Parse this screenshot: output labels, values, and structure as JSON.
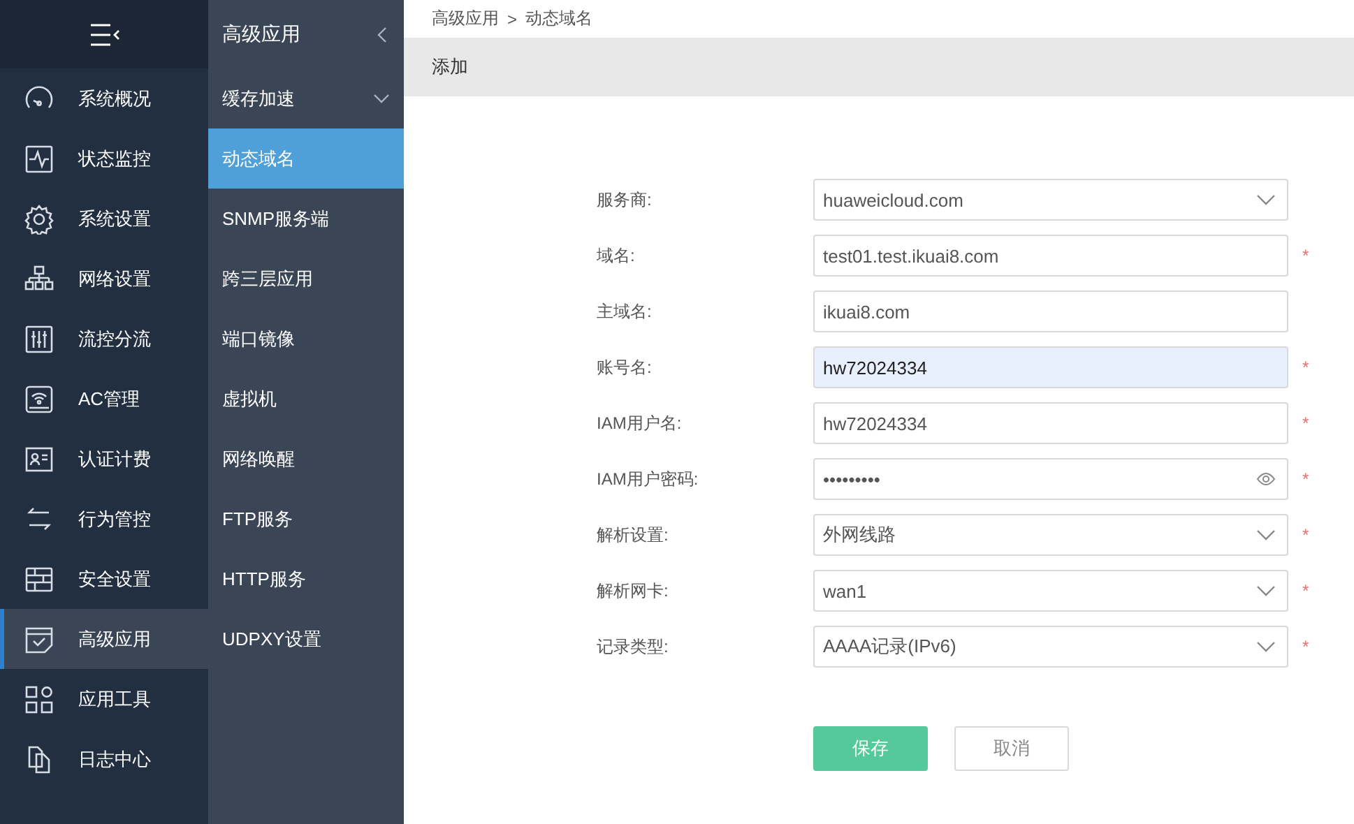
{
  "nav": {
    "items": [
      {
        "label": "系统概况",
        "selected": false
      },
      {
        "label": "状态监控",
        "selected": false
      },
      {
        "label": "系统设置",
        "selected": false
      },
      {
        "label": "网络设置",
        "selected": false
      },
      {
        "label": "流控分流",
        "selected": false
      },
      {
        "label": "AC管理",
        "selected": false
      },
      {
        "label": "认证计费",
        "selected": false
      },
      {
        "label": "行为管控",
        "selected": false
      },
      {
        "label": "安全设置",
        "selected": false
      },
      {
        "label": "高级应用",
        "selected": true
      },
      {
        "label": "应用工具",
        "selected": false
      },
      {
        "label": "日志中心",
        "selected": false
      }
    ]
  },
  "submenu": {
    "title": "高级应用",
    "items": [
      {
        "label": "缓存加速",
        "selected": false,
        "expanded": false
      },
      {
        "label": "动态域名",
        "selected": true
      },
      {
        "label": "SNMP服务端",
        "selected": false
      },
      {
        "label": "跨三层应用",
        "selected": false
      },
      {
        "label": "端口镜像",
        "selected": false
      },
      {
        "label": "虚拟机",
        "selected": false
      },
      {
        "label": "网络唤醒",
        "selected": false
      },
      {
        "label": "FTP服务",
        "selected": false
      },
      {
        "label": "HTTP服务",
        "selected": false
      },
      {
        "label": "UDPXY设置",
        "selected": false
      }
    ]
  },
  "breadcrumb": [
    "高级应用",
    "动态域名"
  ],
  "breadcrumb_separator": ">",
  "panel_title": "添加",
  "form": {
    "fields": [
      {
        "label": "服务商:",
        "kind": "select",
        "value": "huaweicloud.com",
        "required": false,
        "autofilled": false
      },
      {
        "label": "域名:",
        "kind": "text",
        "value": "test01.test.ikuai8.com",
        "required": true,
        "autofilled": false
      },
      {
        "label": "主域名:",
        "kind": "text",
        "value": "ikuai8.com",
        "required": false,
        "autofilled": false
      },
      {
        "label": "账号名:",
        "kind": "text",
        "value": "hw72024334",
        "required": true,
        "autofilled": true
      },
      {
        "label": "IAM用户名:",
        "kind": "text",
        "value": "hw72024334",
        "required": true,
        "autofilled": false
      },
      {
        "label": "IAM用户密码:",
        "kind": "password",
        "value": "•••••••••",
        "required": true,
        "autofilled": false
      },
      {
        "label": "解析设置:",
        "kind": "select",
        "value": "外网线路",
        "required": true,
        "autofilled": false
      },
      {
        "label": "解析网卡:",
        "kind": "select",
        "value": "wan1",
        "required": true,
        "autofilled": false
      },
      {
        "label": "记录类型:",
        "kind": "select",
        "value": "AAAA记录(IPv6)",
        "required": true,
        "autofilled": false
      }
    ],
    "required_mark": "*",
    "buttons": [
      {
        "label": "保存",
        "kind": "primary"
      },
      {
        "label": "取消",
        "kind": "secondary"
      }
    ]
  }
}
